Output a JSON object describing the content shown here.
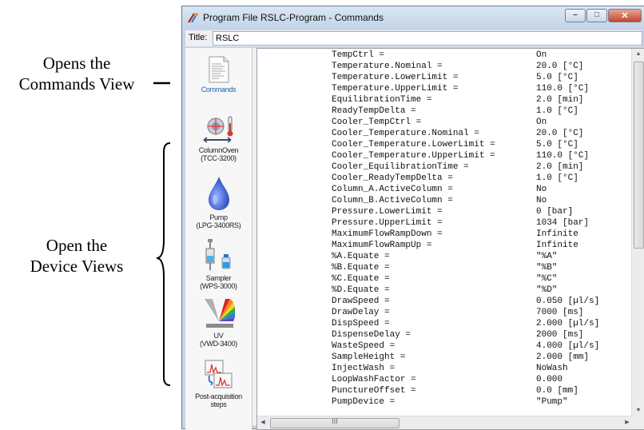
{
  "annotations": {
    "commands_line1": "Opens the",
    "commands_line2": "Commands View",
    "devices_line1": "Open the",
    "devices_line2": "Device Views"
  },
  "window": {
    "title": "Program File RSLC-Program - Commands",
    "controls": {
      "minimize": "–",
      "maximize": "□",
      "close": "✕"
    }
  },
  "title_field": {
    "label": "Title:",
    "value": "RSLC"
  },
  "sidebar": {
    "items": [
      {
        "icon": "commands-icon",
        "label": "Commands"
      },
      {
        "icon": "column-oven-icon",
        "label_line1": "ColumnOven",
        "label_line2": "(TCC-3200)"
      },
      {
        "icon": "pump-icon",
        "label_line1": "Pump",
        "label_line2": "(LPG-3400RS)"
      },
      {
        "icon": "sampler-icon",
        "label_line1": "Sampler",
        "label_line2": "(WPS-3000)"
      },
      {
        "icon": "uv-detector-icon",
        "label_line1": "UV",
        "label_line2": "(VWD-3400)"
      },
      {
        "icon": "post-acquisition-icon",
        "label_line1": "Post-acquisition",
        "label_line2": "steps"
      }
    ]
  },
  "commands": [
    {
      "key": "TempCtrl =",
      "value": "On"
    },
    {
      "key": "Temperature.Nominal =",
      "value": "20.0 [°C]"
    },
    {
      "key": "Temperature.LowerLimit =",
      "value": "5.0 [°C]"
    },
    {
      "key": "Temperature.UpperLimit =",
      "value": "110.0 [°C]"
    },
    {
      "key": "EquilibrationTime =",
      "value": "2.0 [min]"
    },
    {
      "key": "ReadyTempDelta =",
      "value": "1.0 [°C]"
    },
    {
      "key": "Cooler_TempCtrl =",
      "value": "On"
    },
    {
      "key": "Cooler_Temperature.Nominal =",
      "value": "20.0 [°C]"
    },
    {
      "key": "Cooler_Temperature.LowerLimit =",
      "value": "5.0 [°C]"
    },
    {
      "key": "Cooler_Temperature.UpperLimit =",
      "value": "110.0 [°C]"
    },
    {
      "key": "Cooler_EquilibrationTime =",
      "value": "2.0 [min]"
    },
    {
      "key": "Cooler_ReadyTempDelta =",
      "value": "1.0 [°C]"
    },
    {
      "key": "Column_A.ActiveColumn =",
      "value": "No"
    },
    {
      "key": "Column_B.ActiveColumn =",
      "value": "No"
    },
    {
      "key": "Pressure.LowerLimit =",
      "value": "0 [bar]"
    },
    {
      "key": "Pressure.UpperLimit =",
      "value": "1034 [bar]"
    },
    {
      "key": "MaximumFlowRampDown =",
      "value": "Infinite"
    },
    {
      "key": "MaximumFlowRampUp =",
      "value": "Infinite"
    },
    {
      "key": "%A.Equate =",
      "value": "\"%A\""
    },
    {
      "key": "%B.Equate =",
      "value": "\"%B\""
    },
    {
      "key": "%C.Equate =",
      "value": "\"%C\""
    },
    {
      "key": "%D.Equate =",
      "value": "\"%D\""
    },
    {
      "key": "DrawSpeed =",
      "value": "0.050 [µl/s]"
    },
    {
      "key": "DrawDelay =",
      "value": "7000 [ms]"
    },
    {
      "key": "DispSpeed =",
      "value": "2.000 [µl/s]"
    },
    {
      "key": "DispenseDelay =",
      "value": "2000 [ms]"
    },
    {
      "key": "WasteSpeed =",
      "value": "4.000 [µl/s]"
    },
    {
      "key": "SampleHeight =",
      "value": "2.000 [mm]"
    },
    {
      "key": "InjectWash =",
      "value": "NoWash"
    },
    {
      "key": "LoopWashFactor =",
      "value": "0.000"
    },
    {
      "key": "PunctureOffset =",
      "value": "0.0 [mm]"
    },
    {
      "key": "PumpDevice =",
      "value": "\"Pump\""
    }
  ],
  "scrollbar": {
    "h_grip": "III"
  }
}
